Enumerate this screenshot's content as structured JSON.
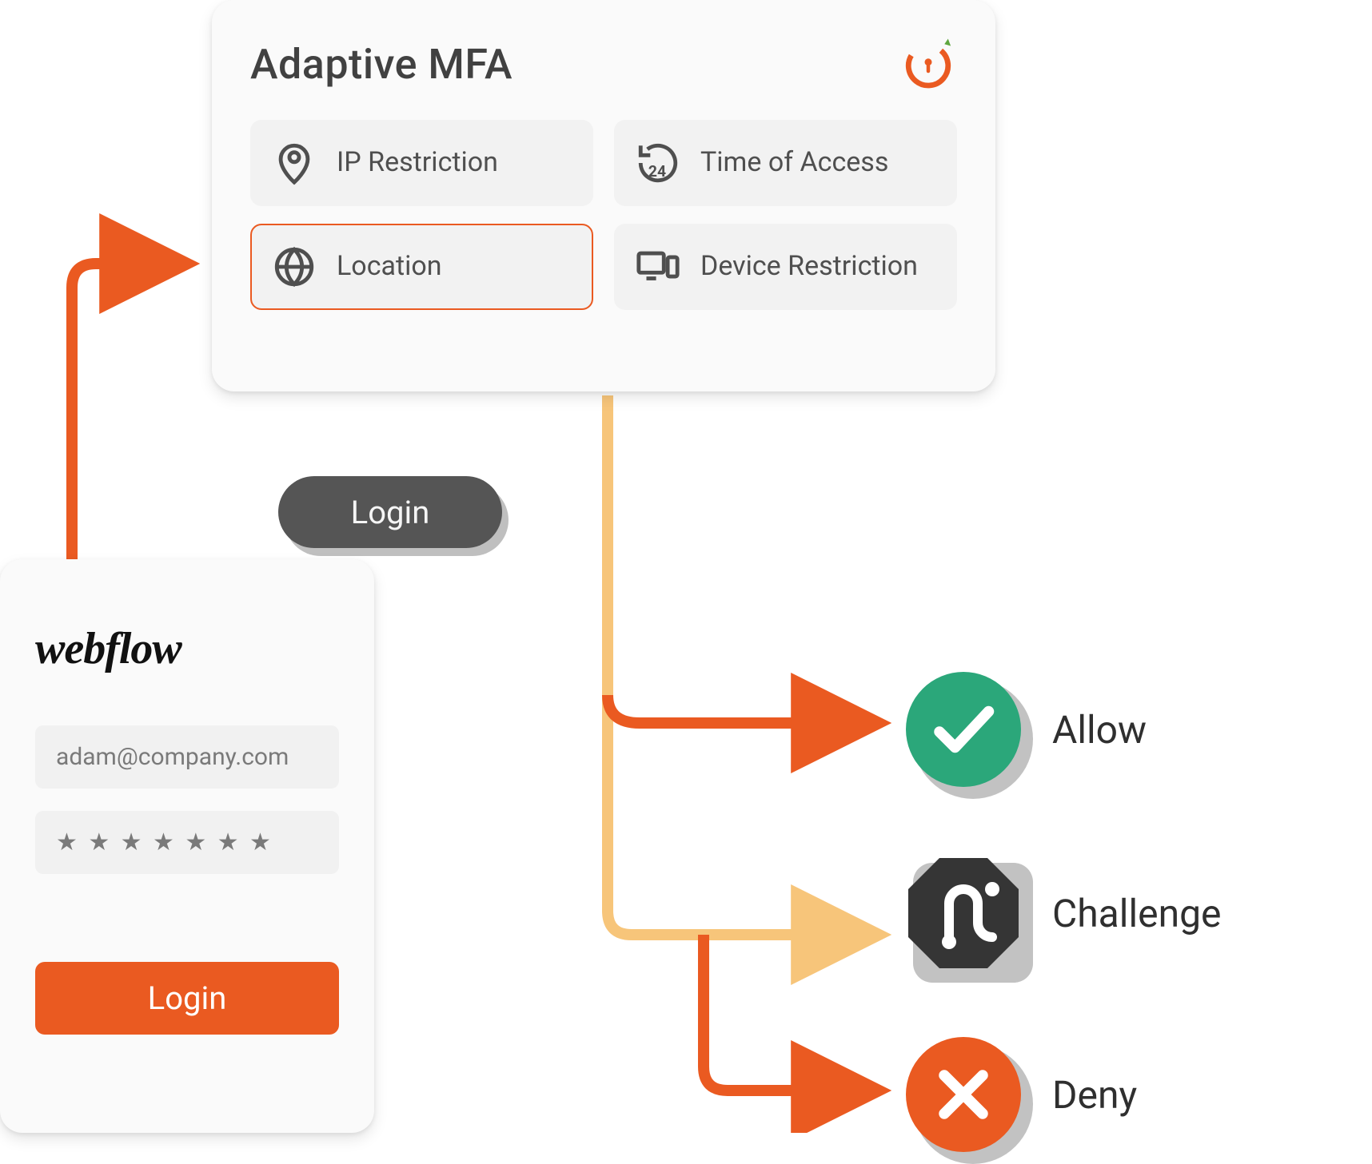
{
  "mfa": {
    "title": "Adaptive MFA",
    "factors": {
      "ip": {
        "label": "IP Restriction"
      },
      "time": {
        "label": "Time of Access"
      },
      "location": {
        "label": "Location"
      },
      "device": {
        "label": "Device Restriction"
      }
    }
  },
  "flow_label": "Login",
  "login_form": {
    "brand": "webflow",
    "email": "adam@company.com",
    "password_mask": "★ ★ ★ ★ ★ ★ ★",
    "submit_label": "Login"
  },
  "outcomes": {
    "allow": {
      "label": "Allow"
    },
    "challenge": {
      "label": "Challenge"
    },
    "deny": {
      "label": "Deny"
    }
  },
  "colors": {
    "accent": "#ea5a21",
    "soft_accent": "#f7c57a",
    "allow": "#2ba77a",
    "challenge": "#353535",
    "deny": "#ea5a21"
  }
}
